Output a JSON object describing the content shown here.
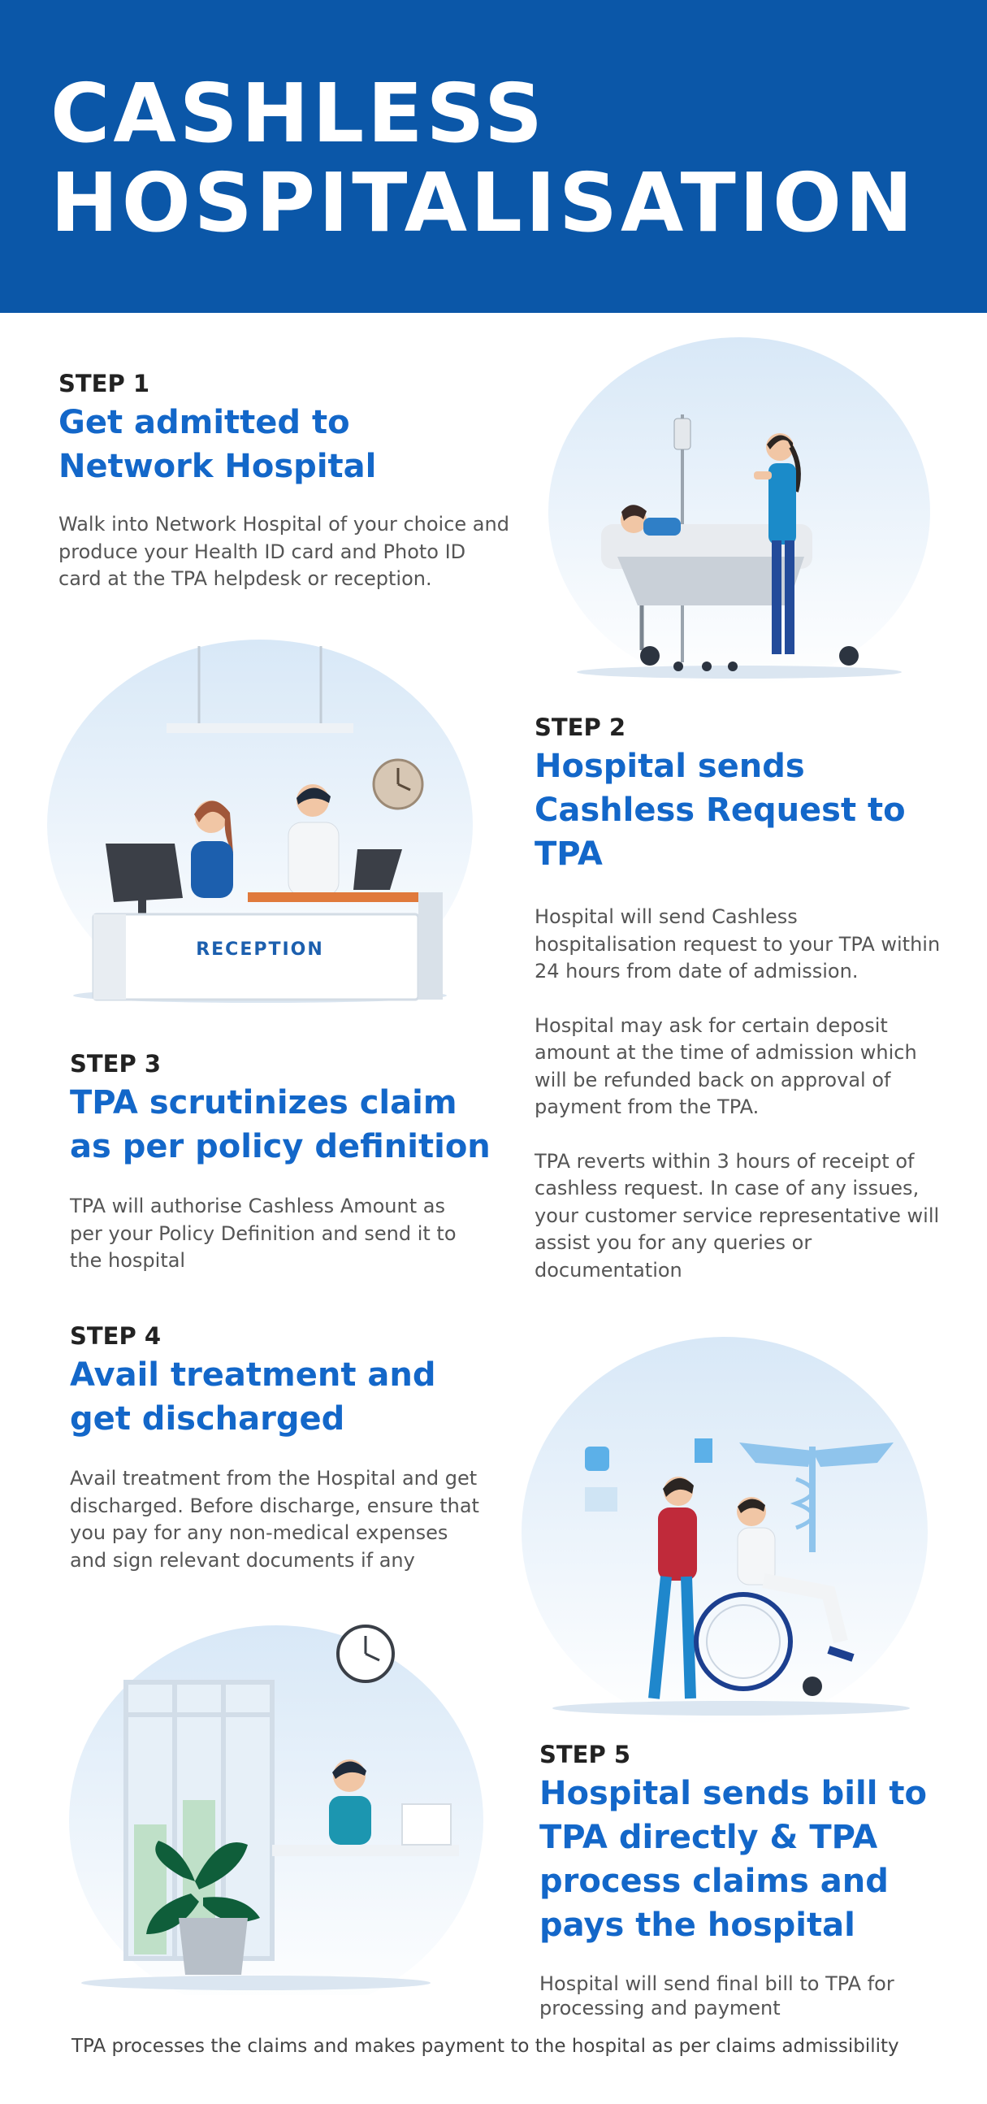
{
  "header": {
    "title_line1": "CASHLESS",
    "title_line2": "HOSPITALISATION"
  },
  "colors": {
    "header_bg": "#0b57a8",
    "accent_blue": "#1367c9",
    "step_label": "#222222",
    "body_text": "#555555"
  },
  "steps": [
    {
      "label": "STEP 1",
      "title": "Get admitted to Network Hospital",
      "paragraphs": [
        "Walk into Network Hospital of your choice and produce your Health ID card and Photo ID card at the TPA helpdesk or reception."
      ]
    },
    {
      "label": "STEP 2",
      "title": "Hospital sends Cashless Request to TPA",
      "paragraphs": [
        "Hospital will send Cashless hospitalisation request to your TPA within 24 hours from date of admission.",
        "Hospital may ask for certain deposit amount at the time of admission which will be refunded back on approval of payment from the TPA.",
        "TPA reverts within 3 hours of receipt of cashless request. In case of any issues, your customer service representative will assist you for any queries or documentation"
      ]
    },
    {
      "label": "STEP 3",
      "title": "TPA scrutinizes claim as per policy definition",
      "paragraphs": [
        "TPA will authorise Cashless Amount as per your Policy Definition and send it to the hospital"
      ]
    },
    {
      "label": "STEP 4",
      "title": "Avail treatment and get discharged",
      "paragraphs": [
        "Avail treatment from the Hospital and get discharged. Before discharge, ensure that you pay for any non-medical expenses and sign relevant documents if any"
      ]
    },
    {
      "label": "STEP 5",
      "title": "Hospital sends bill to TPA directly & TPA process claims and pays the hospital",
      "paragraphs": [
        "Hospital will send final bill to TPA for processing and payment"
      ]
    }
  ],
  "illustrations": {
    "reception_sign": "RECEPTION",
    "icons": [
      "hospital-bed-illustration",
      "reception-desk-illustration",
      "wheelchair-illustration",
      "office-desk-illustration"
    ]
  },
  "footer": {
    "text": "TPA processes the claims and makes payment to the hospital as per claims admissibility"
  }
}
